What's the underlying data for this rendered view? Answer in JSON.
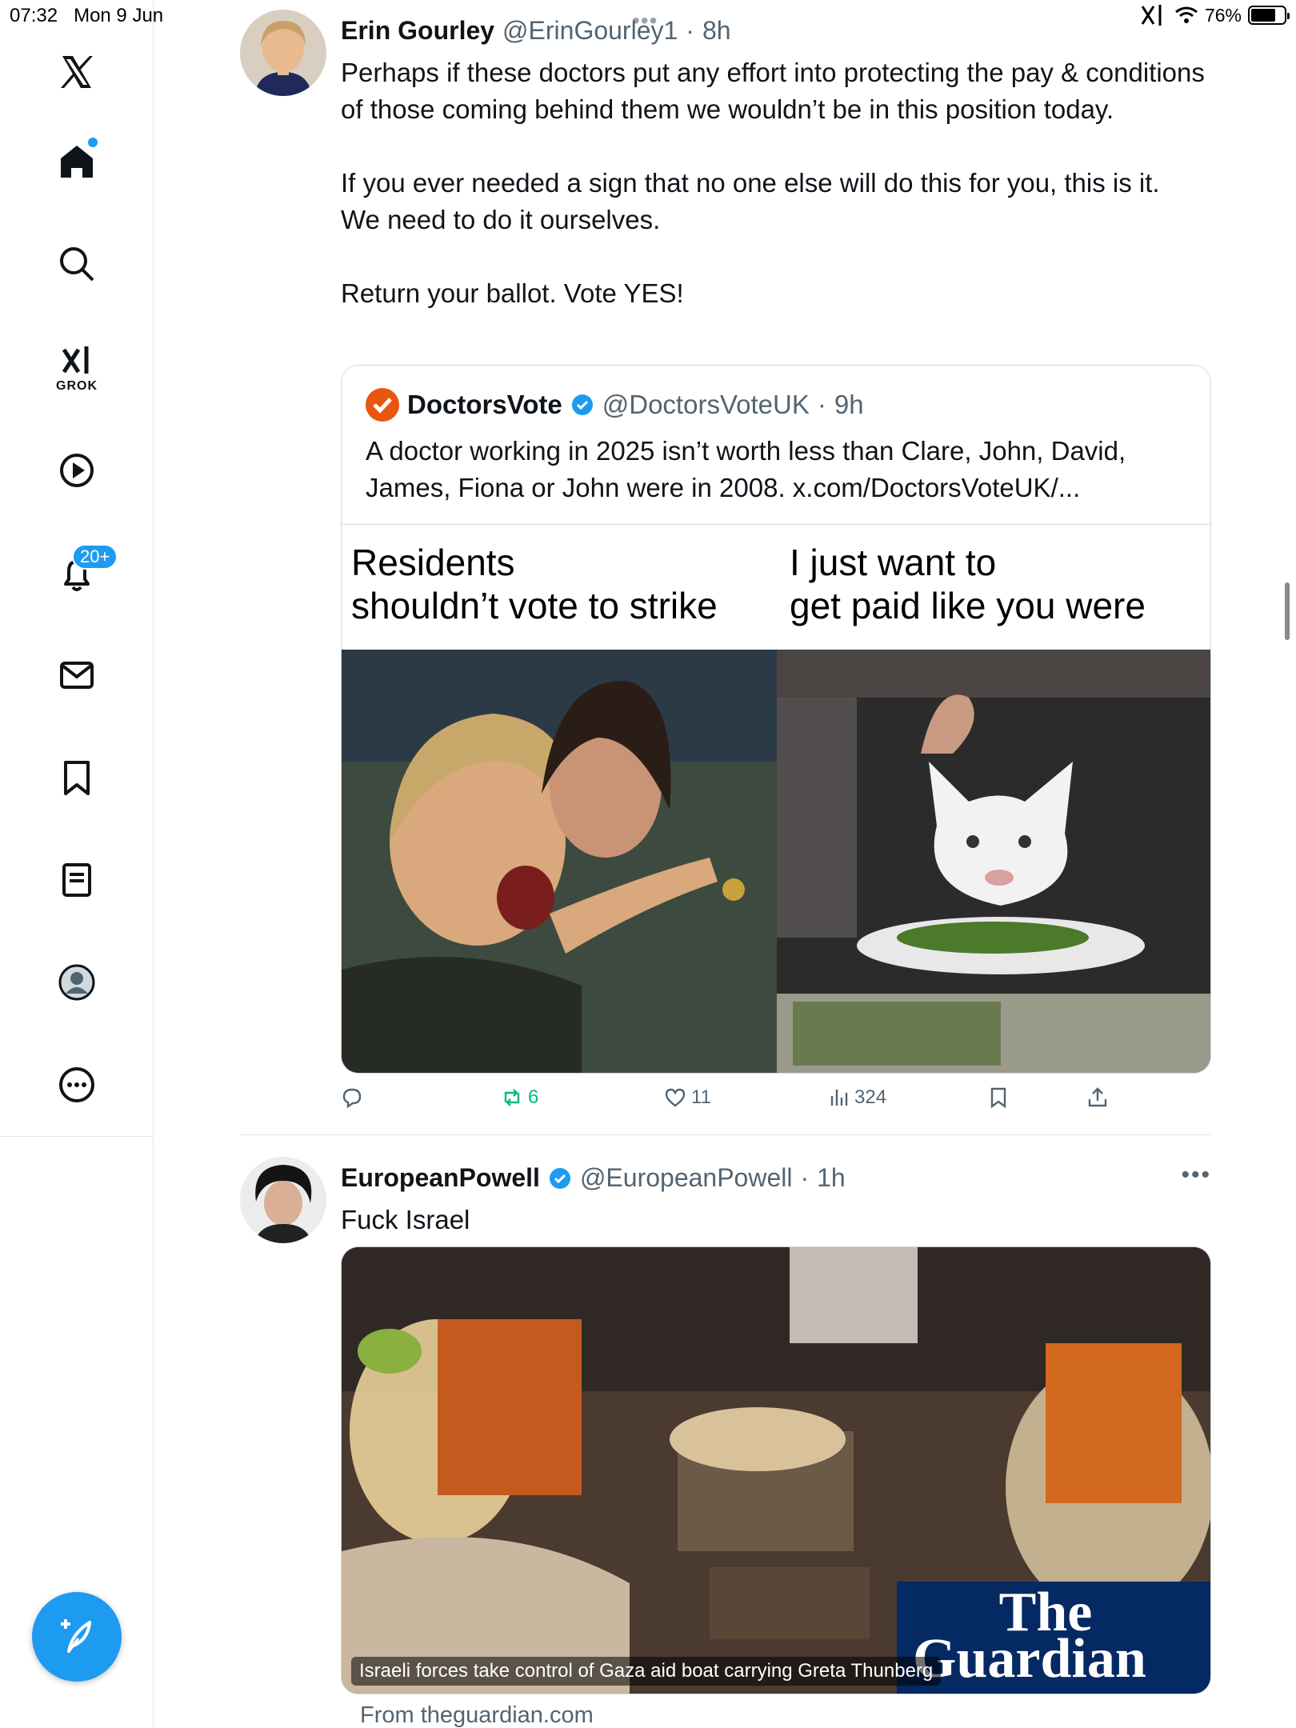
{
  "status_bar": {
    "time": "07:32",
    "date": "Mon 9 Jun",
    "battery": "76%",
    "battery_level": 0.76
  },
  "sidebar": {
    "items": [
      {
        "icon": "x-logo-icon"
      },
      {
        "icon": "home-icon",
        "has_dot": true
      },
      {
        "icon": "search-icon"
      },
      {
        "icon": "grok-icon",
        "label": "GROK"
      },
      {
        "icon": "video-icon"
      },
      {
        "icon": "bell-icon",
        "badge": "20+"
      },
      {
        "icon": "mail-icon"
      },
      {
        "icon": "bookmark-icon"
      },
      {
        "icon": "article-icon"
      },
      {
        "icon": "profile-icon"
      },
      {
        "icon": "more-icon"
      }
    ],
    "compose_icon": "compose-icon",
    "accent": "#1d9bf0"
  },
  "tweet1": {
    "name": "Erin Gourley",
    "handle": "@ErinGourley1",
    "dot": "·",
    "time": "8h",
    "body": "Perhaps if these doctors put any effort into protecting the pay & conditions of those coming behind them we wouldn’t be in this position today.\n\nIf you ever needed a sign that no one else will do this for you, this is it. We need to do it ourselves.\n\nReturn your ballot. Vote YES!",
    "quote": {
      "name": "DoctorsVote",
      "handle": "@DoctorsVoteUK",
      "dot": "·",
      "time": "9h",
      "text": "A doctor working in 2025 isn’t worth less than Clare, John, David, James, Fiona or John were in 2008. x.com/DoctorsVoteUK/...",
      "meme_left_caption": "Residents\nshouldn’t vote to strike",
      "meme_right_caption": "I just want to\nget paid like you were",
      "logo_color": "#e8560f"
    },
    "actions": {
      "reply": "",
      "retweets": "6",
      "likes": "11",
      "views": "324"
    }
  },
  "tweet2": {
    "name": "EuropeanPowell",
    "handle": "@EuropeanPowell",
    "dot": "·",
    "time": "1h",
    "body": "Fuck Israel",
    "card": {
      "caption": "Israeli forces take control of Gaza aid boat carrying Greta Thunberg",
      "brand_line1": "The",
      "brand_line2": "Guardian",
      "source": "From theguardian.com",
      "brand_color": "#052962"
    }
  }
}
